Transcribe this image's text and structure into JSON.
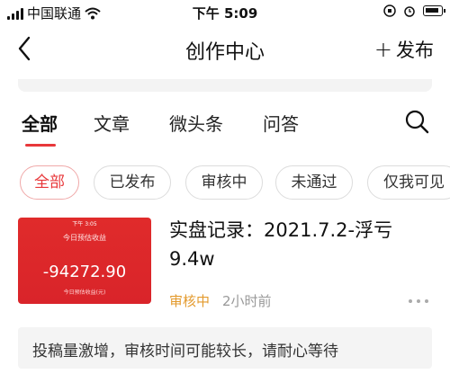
{
  "status_bar": {
    "carrier": "中国联通",
    "time": "下午 5:09"
  },
  "nav": {
    "title": "创作中心",
    "publish_label": "发布",
    "publish_plus": "+"
  },
  "tabs": [
    {
      "label": "全部",
      "active": true
    },
    {
      "label": "文章",
      "active": false
    },
    {
      "label": "微头条",
      "active": false
    },
    {
      "label": "问答",
      "active": false
    }
  ],
  "filters": [
    {
      "label": "全部",
      "active": true
    },
    {
      "label": "已发布",
      "active": false
    },
    {
      "label": "审核中",
      "active": false
    },
    {
      "label": "未通过",
      "active": false
    },
    {
      "label": "仅我可见",
      "active": false
    }
  ],
  "post": {
    "title": "实盘记录：2021.7.2-浮亏9.4w",
    "status": "审核中",
    "time_ago": "2小时前",
    "thumbnail": {
      "status_time": "下午 3:05",
      "title": "今日预估收益",
      "value": "-94272.90",
      "subtitle": "今日预估收益(元)"
    }
  },
  "notice": {
    "text": "投稿量激增，审核时间可能较长，请耐心等待"
  },
  "colors": {
    "accent": "#e8373a",
    "pending": "#e39a2d",
    "thumb_red": "#e02b2b"
  }
}
